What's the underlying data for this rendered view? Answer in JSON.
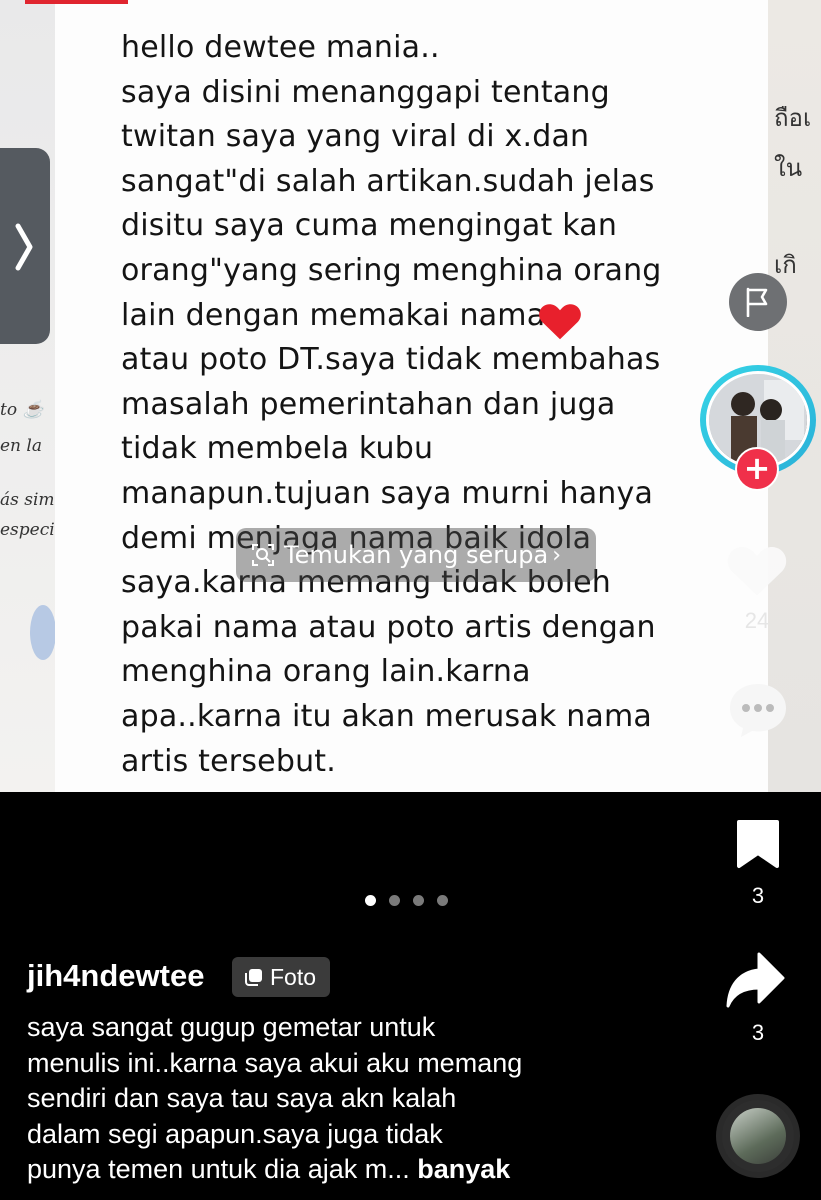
{
  "post": {
    "note_text": "hello dewtee mania..\nsaya disini menanggapi tentang\ntwitan saya yang viral di x.dan\nsangat\"di salah artikan.sudah jelas\ndisitu saya cuma mengingat kan\norang\"yang sering menghina orang\nlain dengan memakai      nama\natau poto DT.saya tidak membahas\nmasalah pemerintahan dan juga\ntidak membela kubu\nmanapun.tujuan saya murni hanya\ndemi menjaga nama baik idola\nsaya.karna memang tidak boleh\npakai nama atau poto artis dengan\nmenghina orang lain.karna\napa..karna itu akan merusak nama\nartis tersebut.",
    "left_fragments": [
      "to ☕",
      "en la",
      "ás sim",
      "especi"
    ],
    "right_fragments": [
      "ถือเ",
      "ใน",
      "เกิ"
    ]
  },
  "overlay": {
    "find_similar_label": "Temukan yang serupa"
  },
  "actions": {
    "likes": "24",
    "saves": "3",
    "shares": "3"
  },
  "carousel": {
    "total": 4,
    "active_index": 0
  },
  "author": {
    "username": "jih4ndewtee",
    "badge_label": "Foto"
  },
  "caption": {
    "text": "saya sangat gugup gemetar untuk\nmenulis ini..karna saya akui aku memang\nsendiri dan saya tau saya akn kalah\ndalam segi apapun.saya juga tidak\npunya temen untuk dia ajak m... ",
    "more_label": "banyak"
  },
  "colors": {
    "follow_plus": "#f0304a",
    "avatar_ring": "#36d4e6",
    "heart": "#e8202c"
  },
  "icons": [
    "chevron-right-icon",
    "report-flag-icon",
    "plus-icon",
    "heart-icon",
    "comment-icon",
    "bookmark-icon",
    "share-icon",
    "search-similar-icon",
    "photo-icon",
    "music-disc-icon"
  ]
}
